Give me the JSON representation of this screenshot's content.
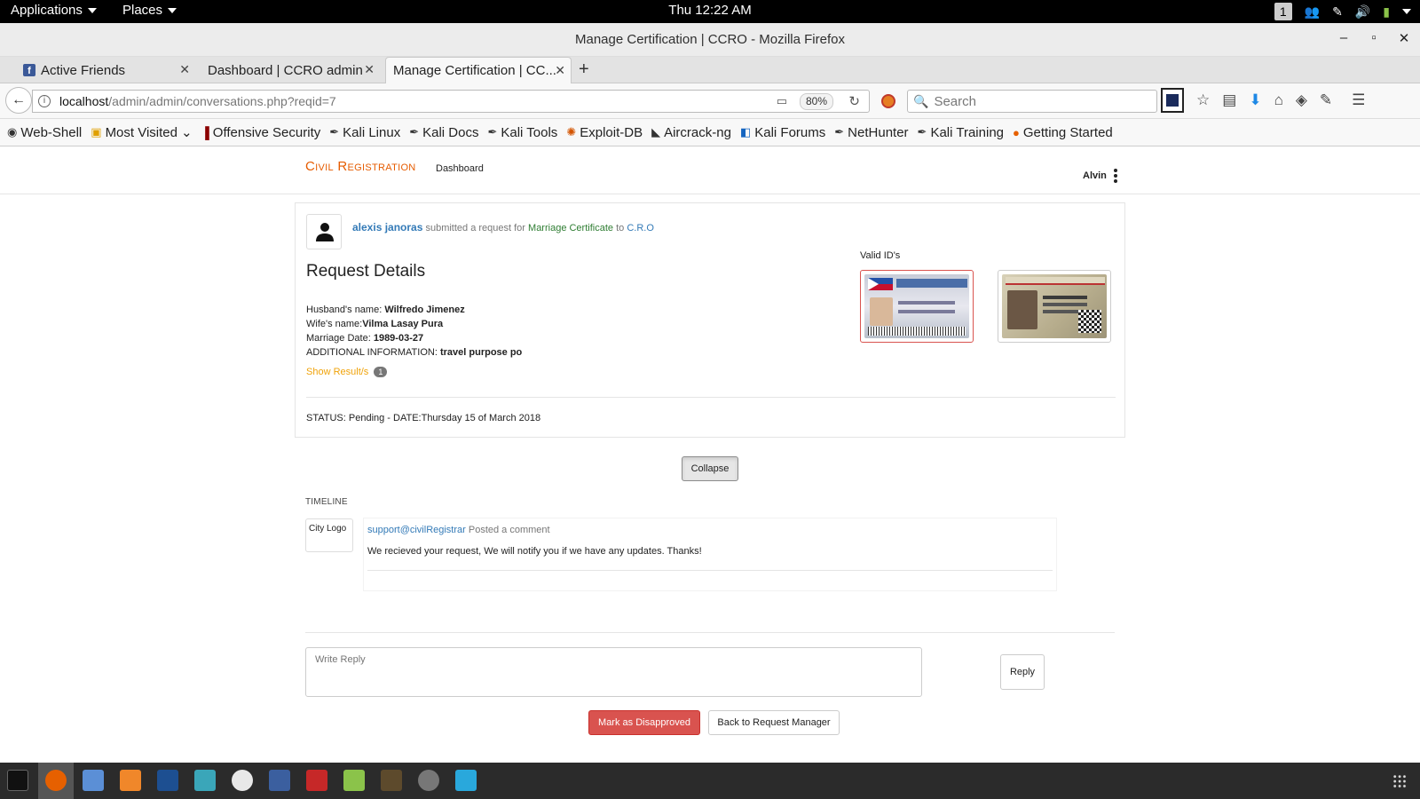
{
  "topbar": {
    "applications": "Applications",
    "places": "Places",
    "clock": "Thu 12:22 AM",
    "workspace": "1"
  },
  "window": {
    "title": "Manage Certification | CCRO - Mozilla Firefox",
    "minimize": "–",
    "maximize": "▫",
    "close": "✕"
  },
  "tabs": [
    {
      "label": "Active Friends",
      "icon": "facebook-icon"
    },
    {
      "label": "Dashboard | CCRO admin"
    },
    {
      "label": "Manage Certification | CC..."
    }
  ],
  "tab_close": "✕",
  "navbar": {
    "url_host": "localhost",
    "url_path": "/admin/admin/conversations.php?reqid=7",
    "zoom": "80%",
    "search_placeholder": "Search"
  },
  "bookmarks": [
    {
      "label": "Web-Shell",
      "icon": "globe-icon"
    },
    {
      "label": "Most Visited",
      "icon": "folder-icon"
    },
    {
      "label": "Offensive Security",
      "icon": "offsec-icon"
    },
    {
      "label": "Kali Linux",
      "icon": "kali-icon"
    },
    {
      "label": "Kali Docs",
      "icon": "kali-icon"
    },
    {
      "label": "Kali Tools",
      "icon": "kali-icon"
    },
    {
      "label": "Exploit-DB",
      "icon": "exploitdb-icon"
    },
    {
      "label": "Aircrack-ng",
      "icon": "aircrack-icon"
    },
    {
      "label": "Kali Forums",
      "icon": "forums-icon"
    },
    {
      "label": "NetHunter",
      "icon": "kali-icon"
    },
    {
      "label": "Kali Training",
      "icon": "kali-icon"
    },
    {
      "label": "Getting Started",
      "icon": "firefox-icon"
    }
  ],
  "site": {
    "brand": "Civil Registration",
    "nav_dashboard": "Dashboard",
    "user": "Alvin"
  },
  "request": {
    "submitter": "alexis janoras",
    "submitted_text": "submitted a request for",
    "certificate": "Marriage Certificate",
    "to_text": "to",
    "office": "C.R.O",
    "title": "Request Details",
    "husband_label": "Husband's name:",
    "husband": "Wilfredo Jimenez",
    "wife_label": "Wife's name:",
    "wife": "Vilma Lasay Pura",
    "marriage_date_label": "Marriage Date:",
    "marriage_date": "1989-03-27",
    "additional_label": "ADDITIONAL INFORMATION:",
    "additional": "travel purpose po",
    "show_results": "Show Result/s",
    "results_count": "1",
    "status": "STATUS: Pending - DATE:Thursday 15 of March 2018",
    "valid_ids_label": "Valid ID's"
  },
  "collapse_label": "Collapse",
  "timeline": {
    "label": "TIMELINE",
    "logo_text": "City Logo",
    "comment_author": "support@civilRegistrar",
    "comment_action": "Posted a comment",
    "comment_body": "We recieved your request, We will notify you if we have any updates. Thanks!"
  },
  "reply": {
    "placeholder": "Write Reply",
    "button": "Reply"
  },
  "actions": {
    "disapprove": "Mark as Disapproved",
    "back": "Back to Request Manager"
  },
  "colors": {
    "brand": "#e65c00",
    "link": "#337ab7",
    "certificate": "#2e7d32",
    "danger": "#d9534f",
    "show_results": "#f0a30a"
  }
}
